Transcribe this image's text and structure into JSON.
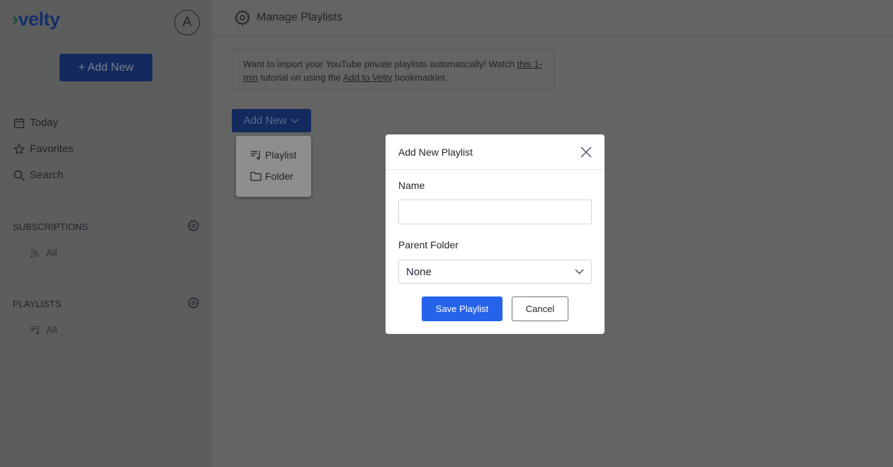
{
  "sidebar": {
    "logo": "velty",
    "avatar_letter": "A",
    "add_new": "Add New",
    "nav": [
      {
        "label": "Today",
        "icon": "calendar-icon"
      },
      {
        "label": "Favorites",
        "icon": "star-icon"
      },
      {
        "label": "Search",
        "icon": "search-icon"
      }
    ],
    "subscriptions": {
      "title": "SUBSCRIPTIONS",
      "item": "All"
    },
    "playlists": {
      "title": "PLAYLISTS",
      "item": "All"
    }
  },
  "header": {
    "title": "Manage Playlists"
  },
  "banner": {
    "text1": "Want to import your YouTube private playlists automatically! Watch ",
    "link1": "this 1-min",
    "text2": " tutorial on using the ",
    "link2": "Add to Velty",
    "text3": " bookmarklet."
  },
  "add_new": {
    "label": "Add New",
    "menu": [
      "Playlist",
      "Folder"
    ]
  },
  "modal": {
    "title": "Add New Playlist",
    "name_label": "Name",
    "name_value": "",
    "parent_label": "Parent Folder",
    "parent_value": "None",
    "save": "Save Playlist",
    "cancel": "Cancel"
  }
}
